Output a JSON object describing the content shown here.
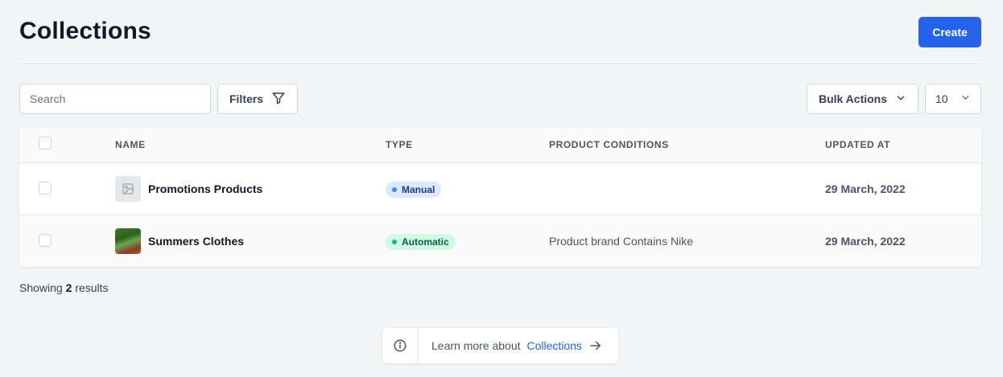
{
  "header": {
    "title": "Collections",
    "create_label": "Create"
  },
  "toolbar": {
    "search_placeholder": "Search",
    "filters_label": "Filters",
    "bulk_actions_label": "Bulk Actions",
    "per_page_value": "10"
  },
  "table": {
    "columns": [
      "NAME",
      "TYPE",
      "PRODUCT CONDITIONS",
      "UPDATED AT"
    ],
    "rows": [
      {
        "name": "Promotions Products",
        "type": "Manual",
        "conditions": "",
        "updated_at": "29 March, 2022",
        "thumb": "image-placeholder-icon"
      },
      {
        "name": "Summers Clothes",
        "type": "Automatic",
        "conditions": "Product brand Contains Nike",
        "updated_at": "29 March, 2022",
        "thumb": "photo"
      }
    ]
  },
  "results": {
    "prefix": "Showing",
    "count": "2",
    "suffix": "results"
  },
  "learn_more": {
    "text": "Learn more about",
    "link": "Collections"
  },
  "colors": {
    "accent": "#2563eb",
    "manual_dot": "#3b82f6",
    "automatic_dot": "#10b981"
  }
}
